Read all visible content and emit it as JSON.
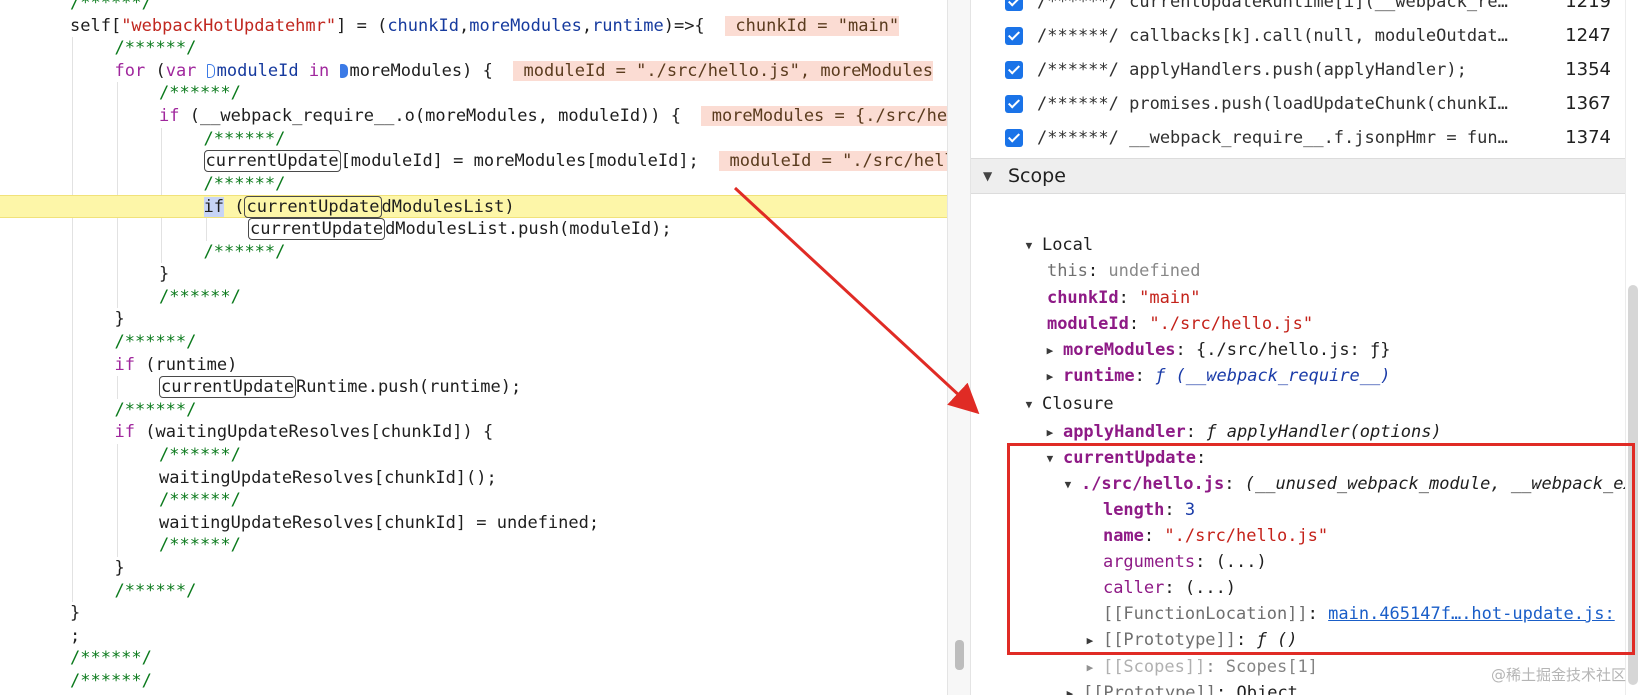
{
  "editor": {
    "lines": [
      {
        "indent": 0,
        "tokens": [
          {
            "t": "c",
            "s": "/******/"
          }
        ]
      },
      {
        "indent": 0,
        "tokens": [
          {
            "s": "self["
          },
          {
            "t": "s",
            "s": "\"webpackHotUpdatehmr\""
          },
          {
            "s": "] = ("
          },
          {
            "t": "v",
            "s": "chunkId"
          },
          {
            "s": ","
          },
          {
            "t": "v",
            "s": "moreModules"
          },
          {
            "s": ","
          },
          {
            "t": "v",
            "s": "runtime"
          },
          {
            "s": ")=>{  "
          },
          {
            "t": "inl",
            "s": " chunkId = \"main\""
          }
        ]
      },
      {
        "indent": 1,
        "tokens": [
          {
            "t": "c",
            "s": "/******/"
          }
        ]
      },
      {
        "indent": 1,
        "tokens": [
          {
            "t": "k",
            "s": "for"
          },
          {
            "s": " ("
          },
          {
            "t": "k",
            "s": "var"
          },
          {
            "s": " "
          },
          {
            "t": "bp"
          },
          {
            "t": "v",
            "s": "moduleId"
          },
          {
            "s": " "
          },
          {
            "t": "k",
            "s": "in"
          },
          {
            "s": " "
          },
          {
            "t": "bpf"
          },
          {
            "s": "moreModules) {  "
          },
          {
            "t": "inl",
            "s": " moduleId = \"./src/hello.js\", moreModules"
          }
        ]
      },
      {
        "indent": 2,
        "tokens": [
          {
            "t": "c",
            "s": "/******/"
          }
        ]
      },
      {
        "indent": 2,
        "tokens": [
          {
            "t": "k",
            "s": "if"
          },
          {
            "s": " (__webpack_require__.o(moreModules, moduleId)) {  "
          },
          {
            "t": "inl",
            "s": " moreModules = {./src/hello.js"
          }
        ]
      },
      {
        "indent": 3,
        "tokens": [
          {
            "t": "c",
            "s": "/******/"
          }
        ]
      },
      {
        "indent": 3,
        "tokens": [
          {
            "t": "b",
            "s": "currentUpdate"
          },
          {
            "s": "[moduleId] = moreModules[moduleId];  "
          },
          {
            "t": "inl",
            "s": " moduleId = \"./src/hello.js\""
          }
        ]
      },
      {
        "indent": 3,
        "tokens": [
          {
            "t": "c",
            "s": "/******/"
          }
        ]
      },
      {
        "indent": 3,
        "paused": true,
        "tokens": [
          {
            "t": "sel",
            "s": "if"
          },
          {
            "s": " ("
          },
          {
            "t": "b",
            "s": "currentUpdate"
          },
          {
            "s": "dModulesList)"
          }
        ]
      },
      {
        "indent": 4,
        "tokens": [
          {
            "t": "b",
            "s": "currentUpdate"
          },
          {
            "s": "dModulesList.push(moduleId);"
          }
        ]
      },
      {
        "indent": 3,
        "tokens": [
          {
            "t": "c",
            "s": "/******/"
          }
        ]
      },
      {
        "indent": 2,
        "tokens": [
          {
            "s": "}"
          }
        ]
      },
      {
        "indent": 2,
        "tokens": [
          {
            "t": "c",
            "s": "/******/"
          }
        ]
      },
      {
        "indent": 1,
        "tokens": [
          {
            "s": "}"
          }
        ]
      },
      {
        "indent": 1,
        "tokens": [
          {
            "t": "c",
            "s": "/******/"
          }
        ]
      },
      {
        "indent": 1,
        "tokens": [
          {
            "t": "k",
            "s": "if"
          },
          {
            "s": " (runtime)"
          }
        ]
      },
      {
        "indent": 2,
        "tokens": [
          {
            "t": "b",
            "s": "currentUpdate"
          },
          {
            "s": "Runtime.push(runtime);"
          }
        ]
      },
      {
        "indent": 1,
        "tokens": [
          {
            "t": "c",
            "s": "/******/"
          }
        ]
      },
      {
        "indent": 1,
        "tokens": [
          {
            "t": "k",
            "s": "if"
          },
          {
            "s": " (waitingUpdateResolves[chunkId]) {"
          }
        ]
      },
      {
        "indent": 2,
        "tokens": [
          {
            "t": "c",
            "s": "/******/"
          }
        ]
      },
      {
        "indent": 2,
        "tokens": [
          {
            "s": "waitingUpdateResolves[chunkId]();"
          }
        ]
      },
      {
        "indent": 2,
        "tokens": [
          {
            "t": "c",
            "s": "/******/"
          }
        ]
      },
      {
        "indent": 2,
        "tokens": [
          {
            "s": "waitingUpdateResolves[chunkId] = undefined;"
          }
        ]
      },
      {
        "indent": 2,
        "tokens": [
          {
            "t": "c",
            "s": "/******/"
          }
        ]
      },
      {
        "indent": 1,
        "tokens": [
          {
            "s": "}"
          }
        ]
      },
      {
        "indent": 1,
        "tokens": [
          {
            "t": "c",
            "s": "/******/"
          }
        ]
      },
      {
        "indent": 0,
        "tokens": [
          {
            "s": "}"
          }
        ]
      },
      {
        "indent": 0,
        "tokens": [
          {
            "s": ";"
          }
        ]
      },
      {
        "indent": 0,
        "tokens": [
          {
            "t": "c",
            "s": "/******/"
          }
        ]
      },
      {
        "indent": 0,
        "tokens": [
          {
            "t": "c",
            "s": "/******/"
          }
        ]
      }
    ]
  },
  "breakpoints": [
    {
      "text": "/******/ currentUpdateRuntime[i](__webpack_require__)",
      "line": "1219",
      "checked": true
    },
    {
      "text": "/******/ callbacks[k].call(null, moduleOutdatedDependencies)",
      "line": "1247",
      "checked": true
    },
    {
      "text": "/******/ applyHandlers.push(applyHandler);",
      "line": "1354",
      "checked": true
    },
    {
      "text": "/******/ promises.push(loadUpdateChunk(chunkId, updatedModulesList))",
      "line": "1367",
      "checked": true
    },
    {
      "text": "/******/ __webpack_require__.f.jsonpHmr = function",
      "line": "1374",
      "checked": true
    }
  ],
  "scope": {
    "header": "Scope",
    "local_label": "Local",
    "this_key": "this",
    "this_val": "undefined",
    "chunk_key": "chunkId",
    "chunk_val": "\"main\"",
    "module_key": "moduleId",
    "module_val": "\"./src/hello.js\"",
    "more_key": "moreModules",
    "more_val": "{./src/hello.js: ƒ}",
    "runtime_key": "runtime",
    "runtime_val": "ƒ (__webpack_require__)",
    "closure_label": "Closure",
    "apply_key": "applyHandler",
    "apply_val": "ƒ applyHandler(options)",
    "cu_key": "currentUpdate",
    "hello_key": "./src/hello.js",
    "hello_val": "(__unused_webpack_module, __webpack_exports__, __webpack_require__)",
    "length_key": "length",
    "length_val": "3",
    "name_key": "name",
    "name_val": "\"./src/hello.js\"",
    "args_key": "arguments",
    "args_val": "(...)",
    "caller_key": "caller",
    "caller_val": "(...)",
    "floc_key": "[[FunctionLocation]]",
    "floc_val": "main.465147f….hot-update.js:",
    "proto_key": "[[Prototype]]",
    "proto_val": "ƒ ()",
    "scopes_key": "[[Scopes]]",
    "scopes_val": "Scopes[1]",
    "proto2_key": "[[Prototype]]",
    "proto2_val": "Object"
  },
  "watermark": "@稀土掘金技术社区",
  "colors": {
    "highlight": "#e02b25",
    "paused_line": "#fdf6a8",
    "checkbox": "#1a73e8"
  }
}
